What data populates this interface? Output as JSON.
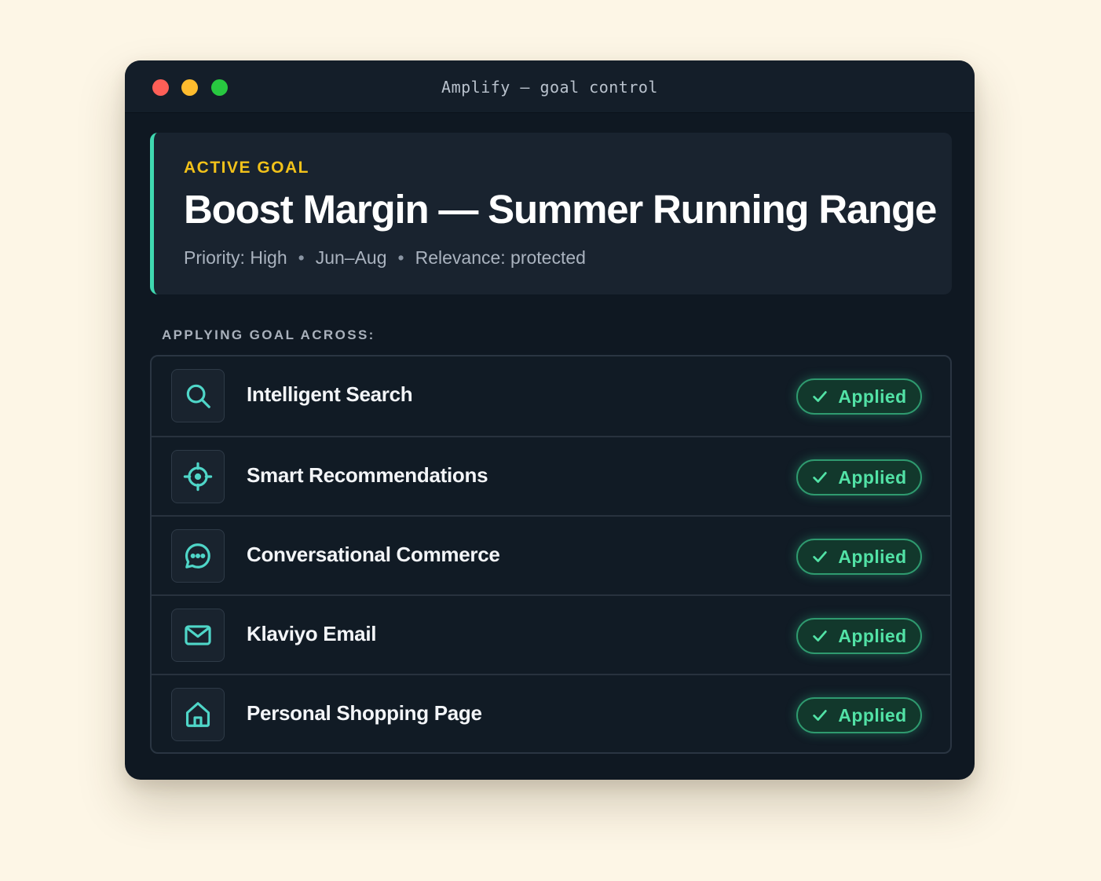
{
  "window": {
    "title": "Amplify – goal control"
  },
  "goal": {
    "kicker": "ACTIVE GOAL",
    "title": "Boost Margin — Summer Running Range",
    "meta": {
      "priority": "Priority: High",
      "period": "Jun–Aug",
      "relevance": "Relevance: protected"
    },
    "accent_color": "#3fd8b0",
    "kicker_color": "#f2c21a"
  },
  "section": {
    "label": "APPLYING GOAL ACROSS:"
  },
  "channels": [
    {
      "label": "Intelligent Search",
      "icon": "search-icon",
      "status": "Applied"
    },
    {
      "label": "Smart Recommendations",
      "icon": "crosshair-icon",
      "status": "Applied"
    },
    {
      "label": "Conversational Commerce",
      "icon": "chat-bubble-icon",
      "status": "Applied"
    },
    {
      "label": "Klaviyo Email",
      "icon": "mail-icon",
      "status": "Applied"
    },
    {
      "label": "Personal Shopping Page",
      "icon": "home-icon",
      "status": "Applied"
    }
  ],
  "colors": {
    "icon": "#4fd6c8",
    "status": "#52e2a6"
  }
}
